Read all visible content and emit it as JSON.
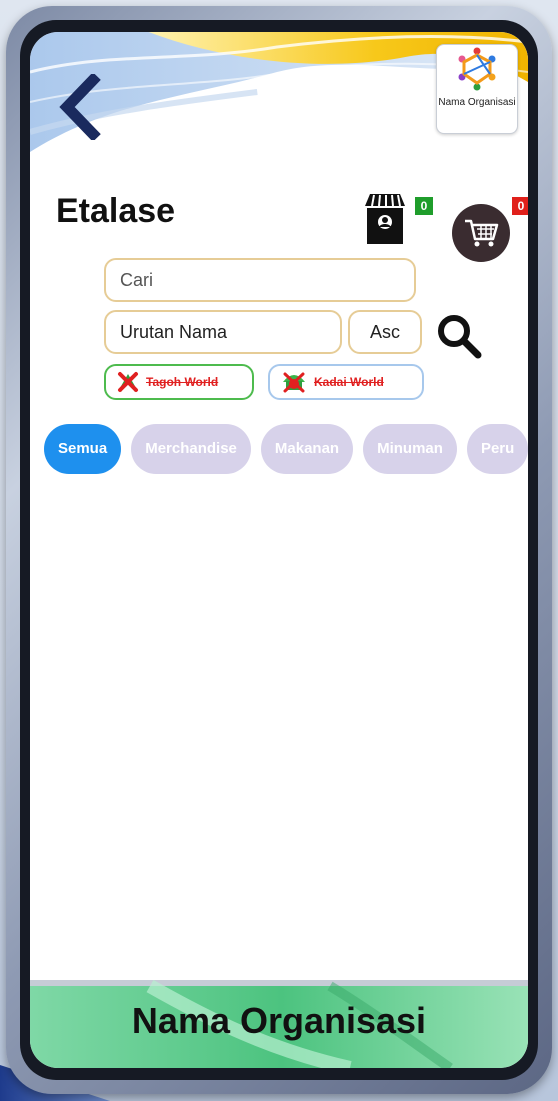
{
  "header": {
    "back_icon": "chevron-left-icon",
    "org_logo_label": "Nama Organisasi"
  },
  "page": {
    "title": "Etalase"
  },
  "store": {
    "icon": "storefront-icon",
    "badge_count": "0",
    "badge_color": "#1f9d2b"
  },
  "cart": {
    "icon": "shopping-cart-icon",
    "badge_count": "0",
    "badge_color": "#e0201b"
  },
  "search": {
    "placeholder": "Cari",
    "sort_value": "Urutan Nama",
    "order_value": "Asc",
    "button_icon": "magnifier-icon"
  },
  "filters": [
    {
      "label": "Tagoh World",
      "icon": "tagoh-icon"
    },
    {
      "label": "Kadai World",
      "icon": "kadai-icon"
    }
  ],
  "tabs": [
    {
      "label": "Semua",
      "active": true
    },
    {
      "label": "Merchandise",
      "active": false
    },
    {
      "label": "Makanan",
      "active": false
    },
    {
      "label": "Minuman",
      "active": false
    },
    {
      "label": "Peru",
      "active": false
    }
  ],
  "footer": {
    "title": "Nama Organisasi"
  },
  "colors": {
    "accent": "#1e90ee",
    "tab_inactive": "#d7d2ea",
    "field_border": "#e6cc96",
    "footer_green": "#5fce8a"
  }
}
